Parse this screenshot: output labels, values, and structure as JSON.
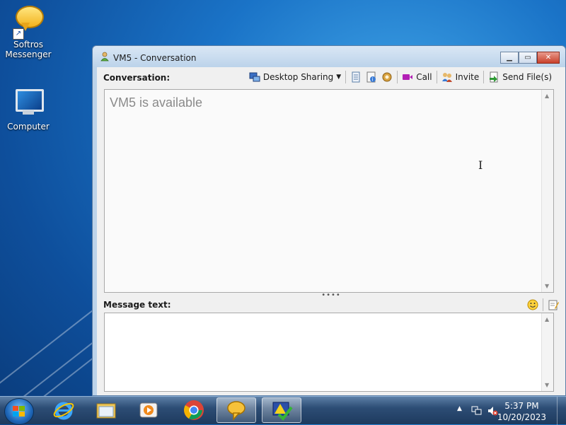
{
  "desktop": {
    "icons": [
      {
        "label_line1": "Softros",
        "label_line2": "Messenger",
        "icon": "softros-messenger-icon"
      },
      {
        "label_line1": "Computer",
        "icon": "computer-icon"
      }
    ]
  },
  "window": {
    "title": "VM5 - Conversation",
    "conversation_label": "Conversation:",
    "toolbar": {
      "desktop_sharing": "Desktop Sharing",
      "call": "Call",
      "invite": "Invite",
      "send_files": "Send File(s)"
    },
    "conversation_status": "VM5 is available",
    "splitter_glyph": "••••",
    "message_label": "Message text:",
    "message_value": ""
  },
  "taskbar": {
    "pinned": [
      "internet-explorer-icon",
      "file-explorer-icon",
      "media-player-icon",
      "chrome-icon",
      "softros-messenger-icon",
      "task-app-icon"
    ],
    "active_index": 4,
    "clock_time": "5:37 PM",
    "clock_date": "10/20/2023",
    "tray_show_hidden": "▲"
  },
  "colors": {
    "desktop_blue": "#1a73c7",
    "taskbar": "#2d4d75",
    "window_frame": "#bcd3ea",
    "close_red": "#c9412b"
  }
}
